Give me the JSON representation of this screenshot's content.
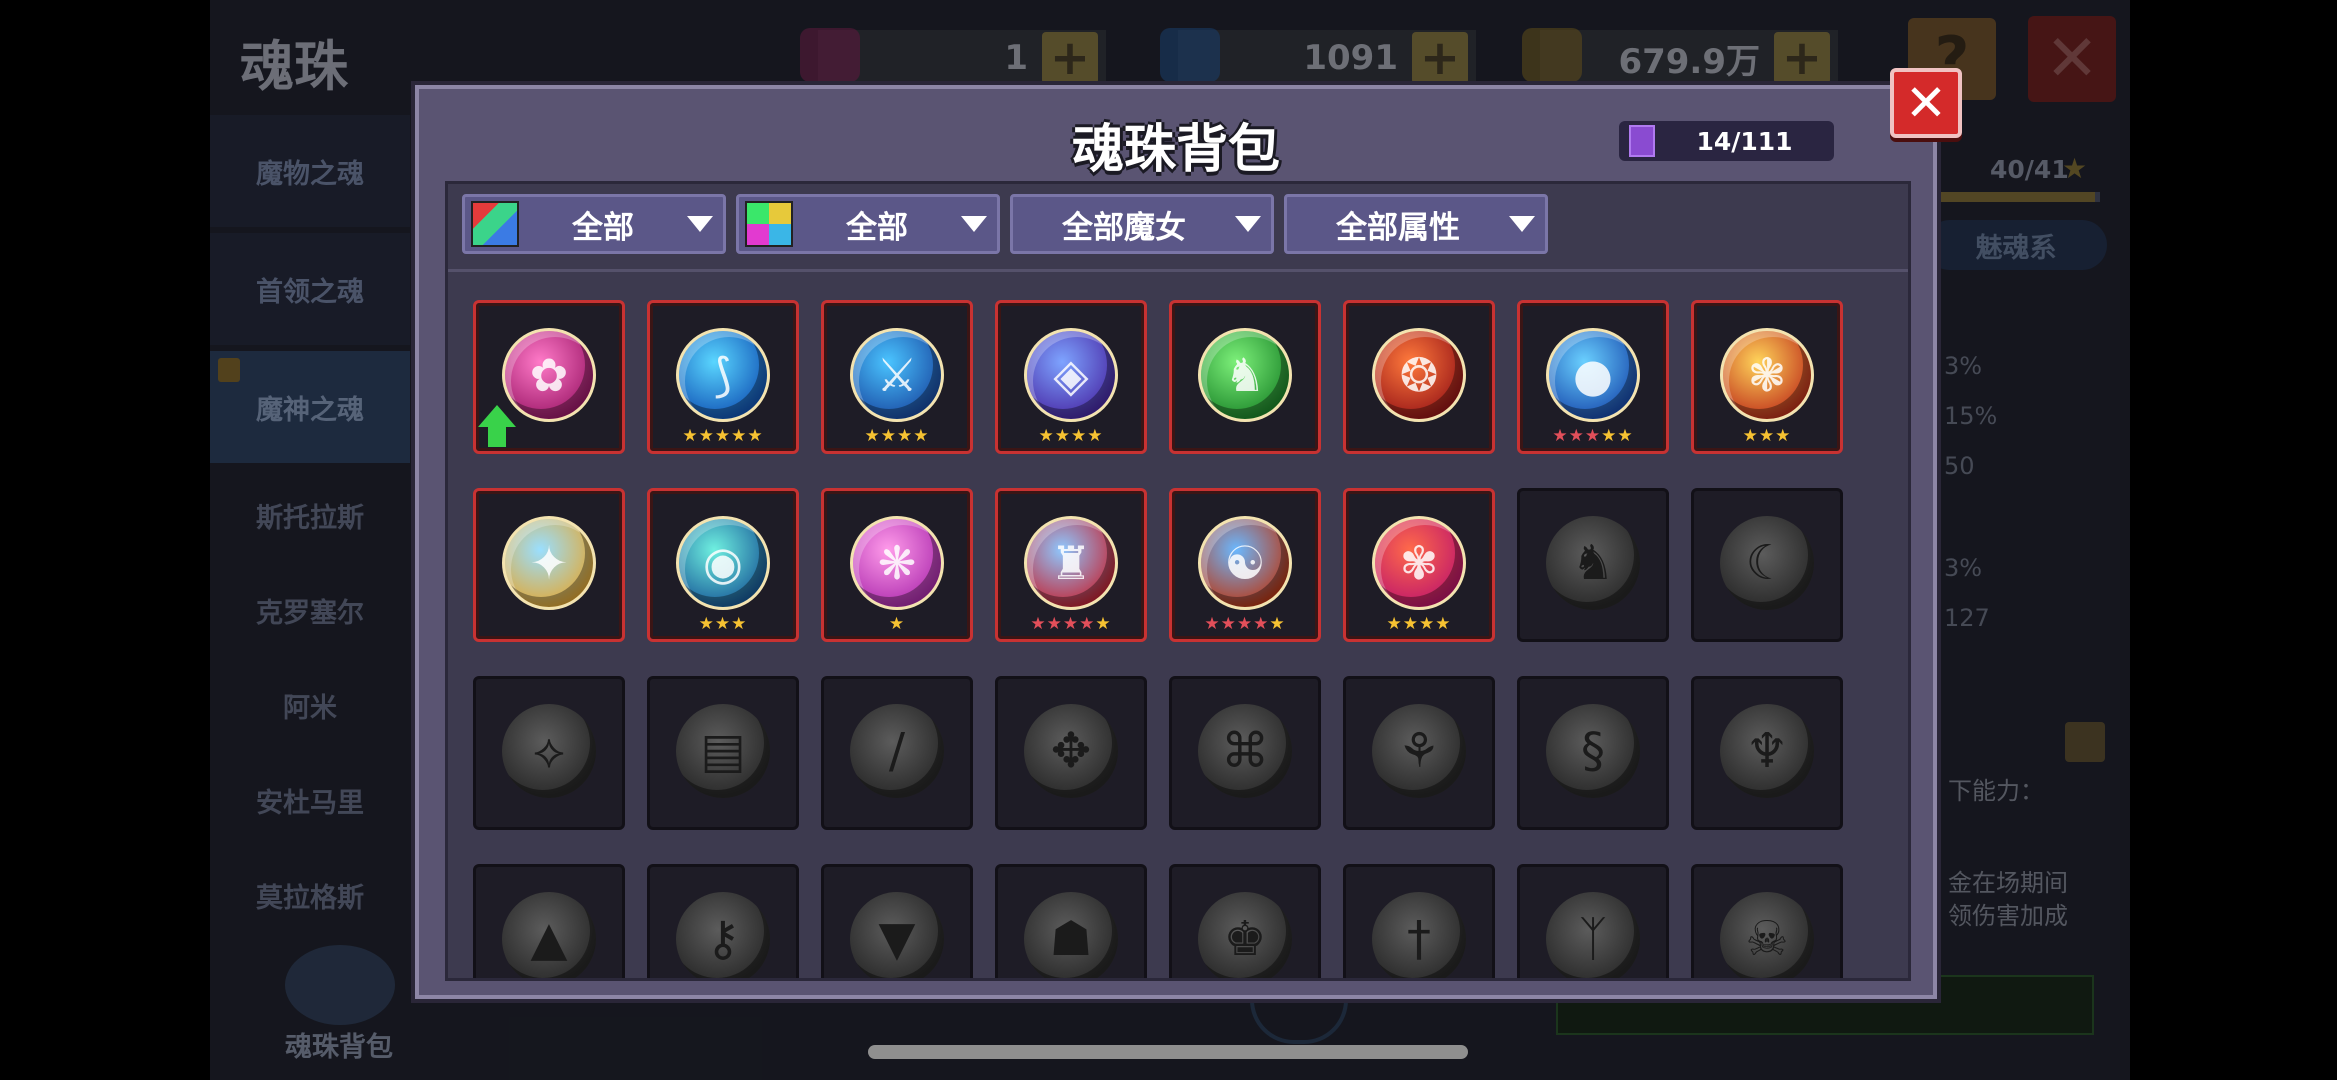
{
  "background": {
    "title": "魂珠",
    "resources": [
      {
        "icon": "red-gem-icon",
        "value": "1"
      },
      {
        "icon": "blue-gem-icon",
        "value": "1091"
      },
      {
        "icon": "gold-coin-icon",
        "value": "679.9万"
      }
    ],
    "help_label": "?",
    "close_label": "✕",
    "sidebar": {
      "tabs": [
        "魔物之魂",
        "首领之魂",
        "魔神之魂"
      ],
      "subs": [
        "斯托拉斯",
        "克罗塞尔",
        "阿米",
        "安杜马里",
        "莫拉格斯"
      ],
      "bag_label": "魂珠背包"
    },
    "right_panel": {
      "count": "40/41",
      "progress": 0.97,
      "pill": "魅魂系",
      "stats": [
        "3%",
        "15%",
        "50",
        "3%",
        "127"
      ],
      "ability_label": "下能力：",
      "desc_lines": [
        "金在场期间",
        "领伤害加成"
      ]
    }
  },
  "modal": {
    "title": "魂珠背包",
    "capacity": "14/111",
    "close_label": "✕",
    "filters": [
      {
        "icon": "rarity-filter-icon",
        "label": "全部"
      },
      {
        "icon": "color-filter-icon",
        "label": "全部"
      },
      {
        "icon": null,
        "label": "全部魔女"
      },
      {
        "icon": null,
        "label": "全部属性"
      }
    ],
    "rows": [
      [
        {
          "state": "owned",
          "icon": "pink-flower-orb-icon",
          "colors": [
            "#ff7ac8",
            "#a01c6c"
          ],
          "glyph": "✿",
          "gold": 0,
          "red": 0,
          "upgrade": true
        },
        {
          "state": "owned",
          "icon": "blue-scroll-orb-icon",
          "colors": [
            "#5ad6ff",
            "#1357b8"
          ],
          "glyph": "⟆",
          "gold": 5,
          "red": 0,
          "upgrade": false
        },
        {
          "state": "owned",
          "icon": "blue-sword-orb-icon",
          "colors": [
            "#4ac4ff",
            "#1b4ea6"
          ],
          "glyph": "⚔",
          "gold": 4,
          "red": 0,
          "upgrade": false
        },
        {
          "state": "owned",
          "icon": "purple-shield-orb-icon",
          "colors": [
            "#7ea4ff",
            "#4a2ca8"
          ],
          "glyph": "◈",
          "gold": 4,
          "red": 0,
          "upgrade": false
        },
        {
          "state": "owned",
          "icon": "green-dragon-orb-icon",
          "colors": [
            "#7df07a",
            "#1f8a2c"
          ],
          "glyph": "♞",
          "gold": 0,
          "red": 0,
          "upgrade": false
        },
        {
          "state": "owned",
          "icon": "red-phoenix-orb-icon",
          "colors": [
            "#ff7a3c",
            "#9a1818"
          ],
          "glyph": "❂",
          "gold": 0,
          "red": 0,
          "upgrade": false
        },
        {
          "state": "owned",
          "icon": "white-pearl-orb-icon",
          "colors": [
            "#6ad0ff",
            "#1a4eb0"
          ],
          "glyph": "●",
          "gold": 2,
          "red": 3,
          "upgrade": false
        },
        {
          "state": "owned",
          "icon": "gold-beast-orb-icon",
          "colors": [
            "#ffd45a",
            "#c0341c"
          ],
          "glyph": "❃",
          "gold": 3,
          "red": 0,
          "upgrade": false
        }
      ],
      [
        {
          "state": "owned",
          "icon": "blue-crystal-orb-icon",
          "colors": [
            "#9adfff",
            "#e0a93a"
          ],
          "glyph": "✦",
          "gold": 0,
          "red": 0,
          "upgrade": false
        },
        {
          "state": "owned",
          "icon": "teal-eye-orb-icon",
          "colors": [
            "#6ff0e0",
            "#1a5d9a"
          ],
          "glyph": "◉",
          "gold": 3,
          "red": 0,
          "upgrade": false
        },
        {
          "state": "owned",
          "icon": "pink-sphere-orb-icon",
          "colors": [
            "#ff9bea",
            "#b030b0"
          ],
          "glyph": "❋",
          "gold": 1,
          "red": 0,
          "upgrade": false
        },
        {
          "state": "owned",
          "icon": "blue-knight-orb-icon",
          "colors": [
            "#8ec8ff",
            "#c2293a"
          ],
          "glyph": "♜",
          "gold": 1,
          "red": 4,
          "upgrade": false
        },
        {
          "state": "owned",
          "icon": "blue-monk-orb-icon",
          "colors": [
            "#6ab8ff",
            "#b83a1a"
          ],
          "glyph": "☯",
          "gold": 1,
          "red": 4,
          "upgrade": false
        },
        {
          "state": "owned",
          "icon": "red-flower-orb-icon",
          "colors": [
            "#ff6a4a",
            "#c0186a"
          ],
          "glyph": "✾",
          "gold": 4,
          "red": 0,
          "upgrade": false
        },
        {
          "state": "locked",
          "icon": "locked-knight-orb-icon",
          "glyph": "♞"
        },
        {
          "state": "locked",
          "icon": "locked-crescent-orb-icon",
          "glyph": "☾"
        }
      ],
      [
        {
          "state": "locked",
          "icon": "locked-claw-orb-icon",
          "glyph": "⟡"
        },
        {
          "state": "locked",
          "icon": "locked-card-orb-icon",
          "glyph": "▤"
        },
        {
          "state": "locked",
          "icon": "locked-blade-orb-icon",
          "glyph": "/"
        },
        {
          "state": "locked",
          "icon": "locked-gear-orb-icon",
          "glyph": "✥"
        },
        {
          "state": "locked",
          "icon": "locked-maze-orb-icon",
          "glyph": "⌘"
        },
        {
          "state": "locked",
          "icon": "locked-ribbon-orb-icon",
          "glyph": "⚘"
        },
        {
          "state": "locked",
          "icon": "locked-serpent-orb-icon",
          "glyph": "§"
        },
        {
          "state": "locked",
          "icon": "locked-dragon-orb-icon",
          "glyph": "♆"
        }
      ],
      [
        {
          "state": "locked",
          "icon": "locked-hat-orb-icon",
          "glyph": "▲"
        },
        {
          "state": "locked",
          "icon": "locked-key-orb-icon",
          "glyph": "⚷"
        },
        {
          "state": "locked",
          "icon": "locked-drill-orb-icon",
          "glyph": "▼"
        },
        {
          "state": "locked",
          "icon": "locked-mask-orb-icon",
          "glyph": "☗"
        },
        {
          "state": "locked",
          "icon": "locked-warrior-orb-icon",
          "glyph": "♚"
        },
        {
          "state": "locked",
          "icon": "locked-sword-orb-icon",
          "glyph": "†"
        },
        {
          "state": "locked",
          "icon": "locked-wing-orb-icon",
          "glyph": "ᛉ"
        },
        {
          "state": "locked",
          "icon": "locked-skull-orb-icon",
          "glyph": "☠"
        }
      ]
    ]
  }
}
